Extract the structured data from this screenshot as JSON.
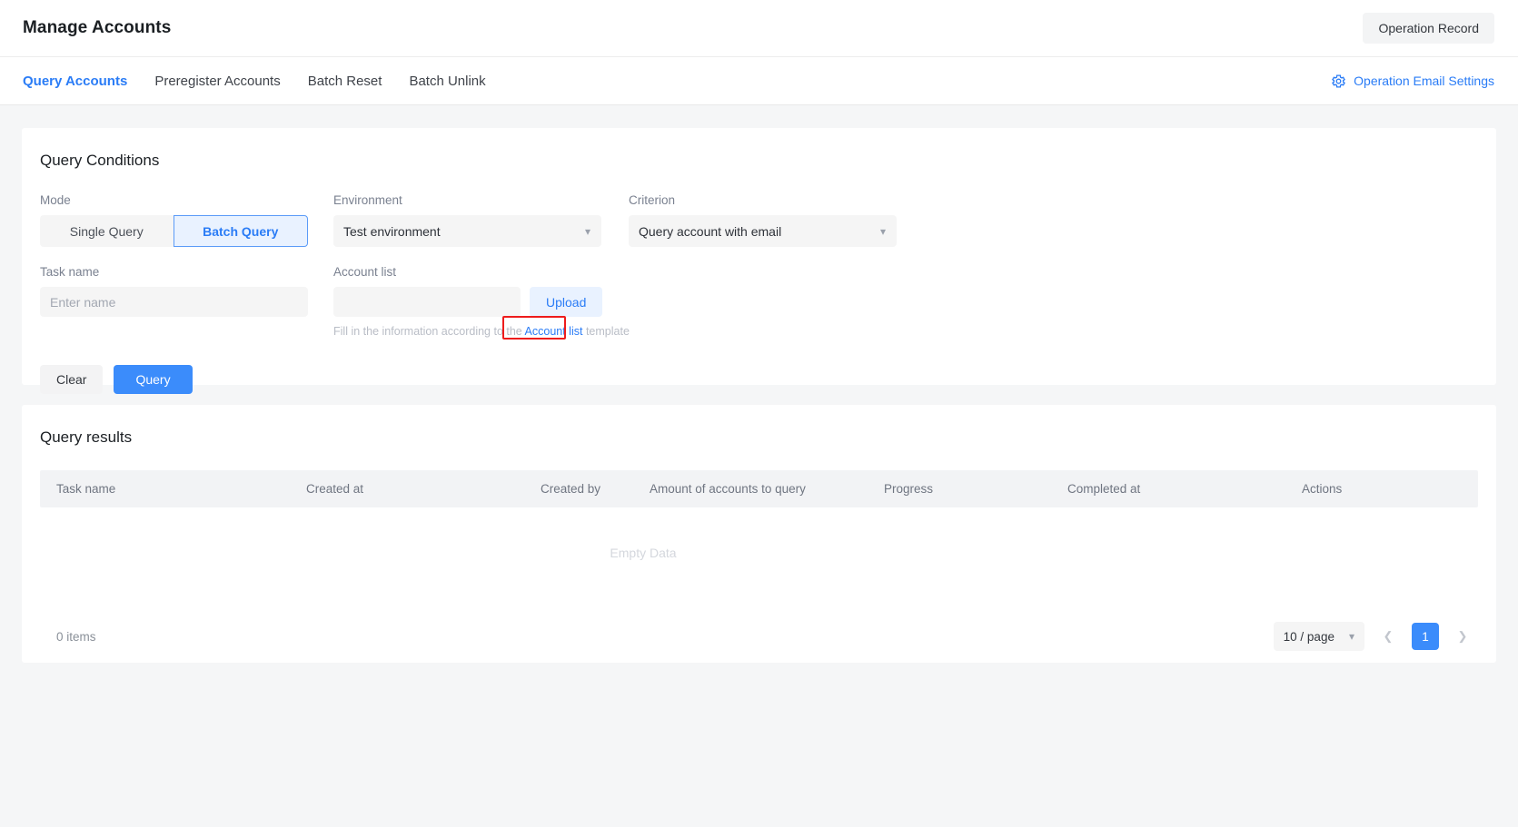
{
  "header": {
    "title": "Manage Accounts",
    "operation_record_label": "Operation Record"
  },
  "tabs": [
    {
      "label": "Query Accounts",
      "active": true
    },
    {
      "label": "Preregister Accounts",
      "active": false
    },
    {
      "label": "Batch Reset",
      "active": false
    },
    {
      "label": "Batch Unlink",
      "active": false
    }
  ],
  "email_settings": {
    "label": "Operation Email Settings",
    "icon": "gear-icon",
    "color": "#2a7cf6"
  },
  "query_conditions": {
    "title": "Query Conditions",
    "mode": {
      "label": "Mode",
      "options": [
        "Single Query",
        "Batch Query"
      ],
      "selected": "Batch Query"
    },
    "environment": {
      "label": "Environment",
      "value": "Test environment",
      "chevron": "chevron-down-icon"
    },
    "criterion": {
      "label": "Criterion",
      "value": "Query account with email",
      "chevron": "chevron-down-icon"
    },
    "task_name": {
      "label": "Task name",
      "value": "",
      "placeholder": "Enter name"
    },
    "account_list": {
      "label": "Account list",
      "file_value": "",
      "upload_label": "Upload",
      "hint_before": "Fill in the information according to the",
      "hint_link": "Account list",
      "hint_after": "template"
    },
    "buttons": {
      "clear": "Clear",
      "query": "Query"
    }
  },
  "query_results": {
    "title": "Query results",
    "columns": [
      "Task name",
      "Created at",
      "Created by",
      "Amount of accounts to query",
      "Progress",
      "Completed at",
      "Actions"
    ],
    "rows": [],
    "empty_text": "Empty Data",
    "pagination": {
      "items_count": "0 items",
      "page_size": "10 / page",
      "prev_icon": "chevron-left-icon",
      "next_icon": "chevron-right-icon",
      "current_page": "1"
    }
  },
  "highlight": {
    "target": "Account list",
    "color": "#ee1c1c"
  }
}
